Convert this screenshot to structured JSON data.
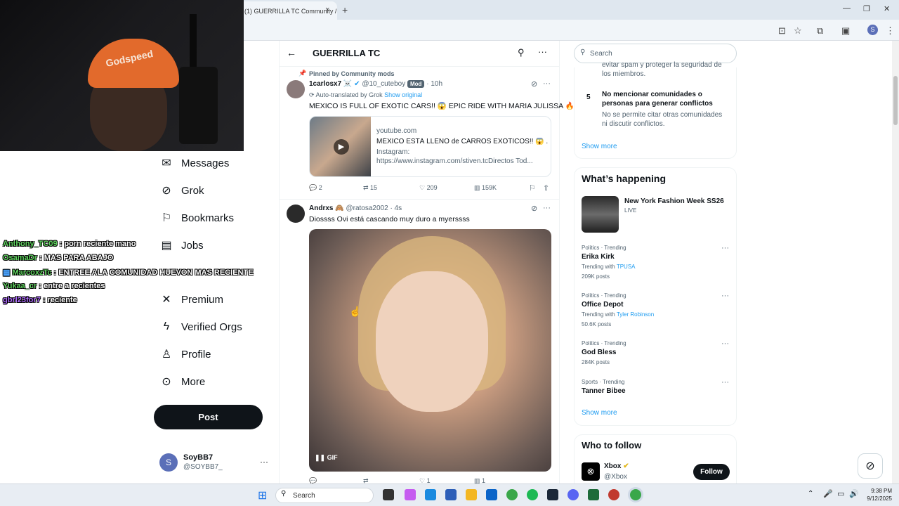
{
  "browser": {
    "tab_title": "(1) GUERRILLA TC Community /",
    "tab_close": "×",
    "new_tab": "+",
    "profile_initial": "S"
  },
  "webcam": {
    "cap_text": "Godspeed"
  },
  "nav": {
    "items": [
      {
        "label": "Messages",
        "icon": "envelope-icon"
      },
      {
        "label": "Grok",
        "icon": "grok-icon"
      },
      {
        "label": "Bookmarks",
        "icon": "bookmark-icon"
      },
      {
        "label": "Jobs",
        "icon": "briefcase-icon"
      },
      {
        "label": "Premium",
        "icon": "x-icon"
      },
      {
        "label": "Verified Orgs",
        "icon": "lightning-icon"
      },
      {
        "label": "Profile",
        "icon": "person-icon"
      },
      {
        "label": "More",
        "icon": "more-circle-icon"
      }
    ],
    "post_label": "Post",
    "account": {
      "initial": "S",
      "name": "SoyBB7",
      "handle": "@SOYBB7_"
    }
  },
  "chat": [
    {
      "user": "Anthony_TC09",
      "sep": " : ",
      "msg": "porn reciente mano",
      "color": "#5fd35f"
    },
    {
      "user": "OsamaDr",
      "sep": " : ",
      "msg": "MAS PARA ABAJO",
      "color": "#5fd35f"
    },
    {
      "user": "MarcoxzTc",
      "sep": " : ",
      "msg": "ENTREE ALA COMUNIDAD HUEVON MAS RECIENTE",
      "color": "#5fd35f"
    },
    {
      "user": "Yukaa_cr",
      "sep": " : ",
      "msg": "entre a recientes",
      "color": "#5fd35f"
    },
    {
      "user": "gbrl23for7",
      "sep": " : ",
      "msg": "reciente",
      "color": "#b06bff"
    }
  ],
  "header": {
    "title": "GUERRILLA TC"
  },
  "tweet1": {
    "pinned": "Pinned by Community mods",
    "name": "1carlosx7 ☠️",
    "handle": "@10_cuteboy",
    "badge": "Mod",
    "time": "· 10h",
    "translated": "Auto-translated by Grok",
    "show_original": "Show original",
    "text": "MEXICO IS FULL OF EXOTIC CARS!! 😱 EPIC RIDE WITH MARIA JULISSA 🔥",
    "card": {
      "domain": "youtube.com",
      "title": "MÉXICO ESTÁ LLENO de CARROS EXÓTICOS!! 😱 ...",
      "desc1": "Instagram:",
      "desc2": "https://www.instagram.com/stiven.tcDirectos Tod..."
    },
    "replies": "2",
    "reposts": "15",
    "likes": "209",
    "views": "159K"
  },
  "tweet2": {
    "name": "Andrxs 🙈",
    "handle": "@ratosa2002",
    "time": "· 4s",
    "text": "Diossss Ovi está cascando muy duro a myerssss",
    "gif_label": "GIF",
    "likes": "1",
    "views": "1"
  },
  "right": {
    "search_placeholder": "Search",
    "rule_partial_1": "evitar spam y proteger la seguridad de",
    "rule_partial_2": "los miembros.",
    "rule5_num": "5",
    "rule5_title_1": "No mencionar comunidades o",
    "rule5_title_2": "personas para generar conflictos",
    "rule5_desc_1": "No se permite citar otras comunidades",
    "rule5_desc_2": "ni discutir conflictos.",
    "show_more_1": "Show more",
    "happening_title": "What’s happening",
    "event": {
      "title": "New York Fashion Week SS26",
      "status": "LIVE"
    },
    "trends": [
      {
        "meta": "Politics · Trending",
        "name": "Erika Kirk",
        "with_label": "Trending with",
        "with_link": "TPUSA",
        "posts": "209K posts"
      },
      {
        "meta": "Politics · Trending",
        "name": "Office Depot",
        "with_label": "Trending with",
        "with_link": "Tyler Robinson",
        "posts": "50.6K posts"
      },
      {
        "meta": "Politics · Trending",
        "name": "God Bless",
        "posts": "284K posts"
      },
      {
        "meta": "Sports · Trending",
        "name": "Tanner Bibee"
      }
    ],
    "show_more_2": "Show more",
    "who_title": "Who to follow",
    "follow": {
      "name": "Xbox",
      "handle": "@Xbox",
      "button": "Follow"
    }
  },
  "taskbar": {
    "search": "Search",
    "time": "9:38 PM",
    "date": "9/12/2025"
  }
}
